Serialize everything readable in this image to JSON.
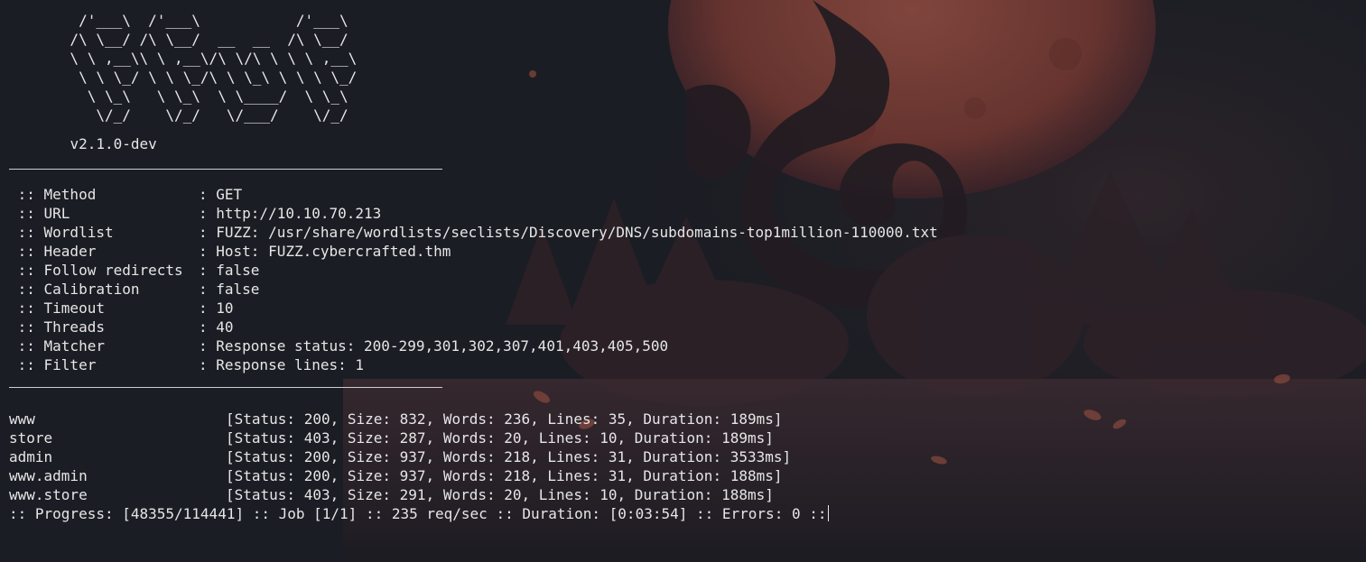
{
  "banner": {
    "ascii_art": "        /'___\\  /'___\\           /'___\\\n       /\\ \\__/ /\\ \\__/  __  __  /\\ \\__/\n       \\ \\ ,__\\\\ \\ ,__\\/\\ \\/\\ \\ \\ \\ ,__\\\n        \\ \\ \\_/ \\ \\ \\_/\\ \\ \\_\\ \\ \\ \\ \\_/\n         \\ \\_\\   \\ \\_\\  \\ \\____/  \\ \\_\\\n          \\/_/    \\/_/   \\/___/    \\/_/",
    "version": "v2.1.0-dev"
  },
  "config": [
    {
      "label": "Method",
      "value": "GET"
    },
    {
      "label": "URL",
      "value": "http://10.10.70.213"
    },
    {
      "label": "Wordlist",
      "value": "FUZZ: /usr/share/wordlists/seclists/Discovery/DNS/subdomains-top1million-110000.txt"
    },
    {
      "label": "Header",
      "value": "Host: FUZZ.cybercrafted.thm"
    },
    {
      "label": "Follow redirects",
      "value": "false"
    },
    {
      "label": "Calibration",
      "value": "false"
    },
    {
      "label": "Timeout",
      "value": "10"
    },
    {
      "label": "Threads",
      "value": "40"
    },
    {
      "label": "Matcher",
      "value": "Response status: 200-299,301,302,307,401,403,405,500"
    },
    {
      "label": "Filter",
      "value": "Response lines: 1"
    }
  ],
  "prefix": " :: ",
  "separator": ": ",
  "results": [
    {
      "word": "www",
      "details": "[Status: 200, Size: 832, Words: 236, Lines: 35, Duration: 189ms]"
    },
    {
      "word": "store",
      "details": "[Status: 403, Size: 287, Words: 20, Lines: 10, Duration: 189ms]"
    },
    {
      "word": "admin",
      "details": "[Status: 200, Size: 937, Words: 218, Lines: 31, Duration: 3533ms]"
    },
    {
      "word": "www.admin",
      "details": "[Status: 200, Size: 937, Words: 218, Lines: 31, Duration: 188ms]"
    },
    {
      "word": "www.store",
      "details": "[Status: 403, Size: 291, Words: 20, Lines: 10, Duration: 188ms]"
    }
  ],
  "progress_line": ":: Progress: [48355/114441] :: Job [1/1] :: 235 req/sec :: Duration: [0:03:54] :: Errors: 0 ::",
  "colors": {
    "background": "#1b1d24",
    "text": "#e6e6e6",
    "wallpaper_moon": "#7a3a34",
    "wallpaper_dark": "#2a2026"
  }
}
